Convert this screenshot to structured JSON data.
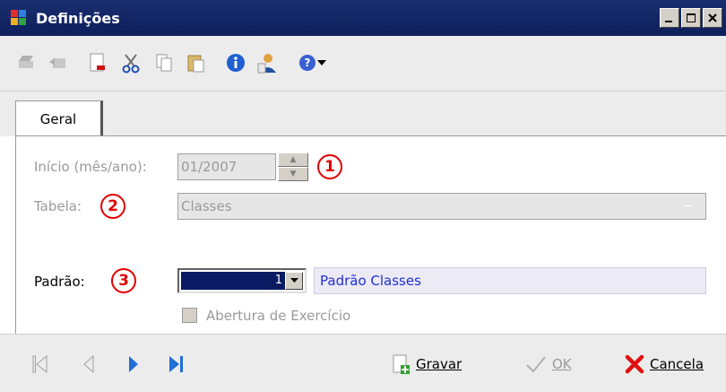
{
  "window": {
    "title": "Definições",
    "controls": [
      "minimize",
      "maximize",
      "close"
    ]
  },
  "toolbar": {
    "icons": [
      "save-disabled-icon",
      "undo-disabled-icon",
      "new-icon",
      "cut-icon",
      "copy-icon",
      "paste-icon",
      "info-icon",
      "user-icon",
      "help-icon"
    ]
  },
  "tabs": [
    {
      "label": "Geral"
    }
  ],
  "form": {
    "inicio": {
      "label": "Início (mês/ano):",
      "value": "01/2007",
      "badge": "1"
    },
    "tabela": {
      "label": "Tabela:",
      "value": "Classes",
      "badge": "2"
    },
    "padrao": {
      "label": "Padrão:",
      "value": "1",
      "description": "Padrão Classes",
      "badge": "3"
    },
    "abertura": {
      "label": "Abertura de Exercício",
      "checked": false
    }
  },
  "footer": {
    "nav": [
      "first-record",
      "previous-record",
      "next-record",
      "last-record"
    ],
    "gravar": "Gravar",
    "ok": "OK",
    "cancela": "Cancela"
  },
  "colors": {
    "titlebar": "#0d1f5c",
    "badge": "#e00000",
    "selection": "#0a1a63",
    "description_text": "#1f2fd6",
    "nav_arrow": "#1f6fd6"
  }
}
